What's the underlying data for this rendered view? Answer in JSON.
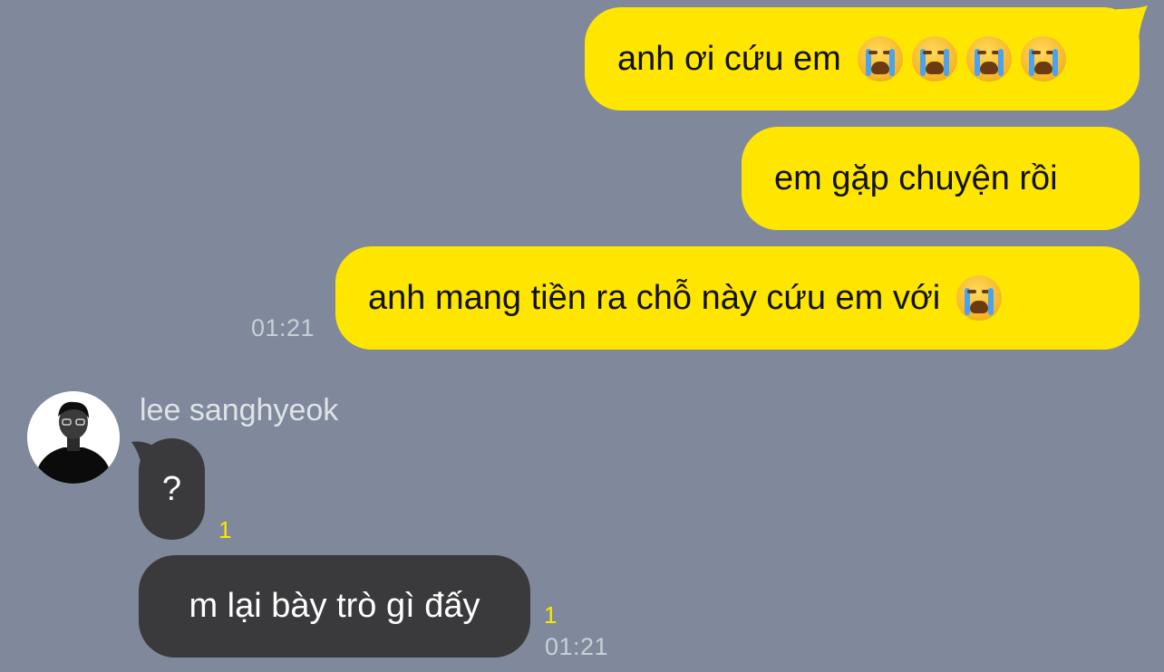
{
  "outgoing": [
    {
      "text": "anh ơi cứu em",
      "emoji_count": 4,
      "emoji": "loudly-crying-face-icon"
    },
    {
      "text": "em gặp chuyện rồi",
      "emoji_count": 0
    },
    {
      "text": "anh mang tiền ra chỗ này cứu em với",
      "emoji_count": 1,
      "emoji": "loudly-crying-face-icon",
      "time": "01:21"
    }
  ],
  "contact": {
    "name": "lee sanghyeok"
  },
  "incoming": [
    {
      "text": "?",
      "unread": "1"
    },
    {
      "text": "m lại bày trò gì đấy",
      "unread": "1",
      "time": "01:21"
    }
  ],
  "colors": {
    "background": "#7f899b",
    "outgoing_bubble": "#ffe600",
    "incoming_bubble": "#3a3a3c",
    "unread": "#ffe600"
  }
}
